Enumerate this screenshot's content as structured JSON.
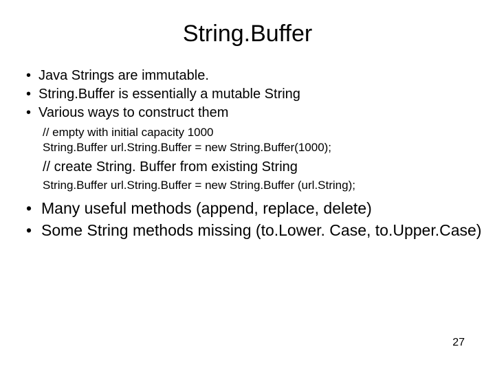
{
  "title": "String.Buffer",
  "bullets_top": [
    "Java Strings are immutable.",
    "String.Buffer is essentially a mutable String",
    "Various ways to construct them"
  ],
  "code1": [
    "// empty with initial capacity 1000",
    "String.Buffer url.String.Buffer = new String.Buffer(1000);"
  ],
  "mid_line": "// create String. Buffer from existing String",
  "code2": [
    "String.Buffer url.String.Buffer = new String.Buffer (url.String);"
  ],
  "bullets_bottom": [
    "Many useful methods (append, replace, delete)",
    "Some String methods missing (to.Lower. Case, to.Upper.Case)"
  ],
  "page_number": "27"
}
